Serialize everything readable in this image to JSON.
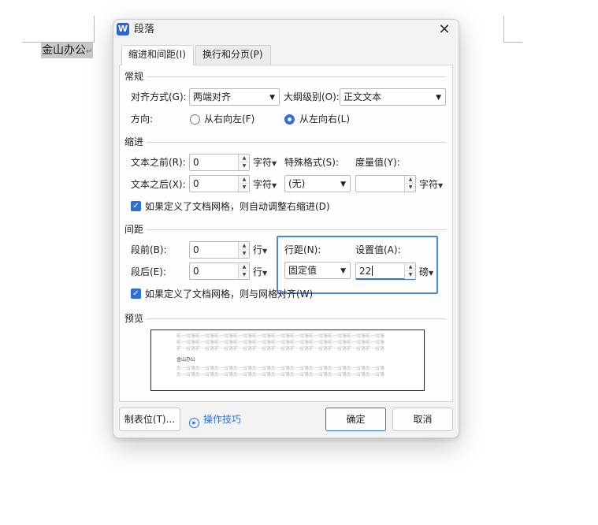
{
  "document": {
    "text": "金山办公",
    "para_mark": "↵"
  },
  "dialog": {
    "app_icon": "W",
    "title": "段落",
    "close_glyph": "✕",
    "tabs": [
      {
        "label": "缩进和间距(I)",
        "active": true
      },
      {
        "label": "换行和分页(P)",
        "active": false
      }
    ],
    "general": {
      "title": "常规",
      "alignment_label": "对齐方式(G):",
      "alignment_value": "两端对齐",
      "outline_label": "大纲级别(O):",
      "outline_value": "正文文本",
      "direction_label": "方向:",
      "direction_options": [
        "从右向左(F)",
        "从左向右(L)"
      ],
      "direction_selected": "从左向右(L)"
    },
    "indent": {
      "title": "缩进",
      "before_label": "文本之前(R):",
      "before_value": "0",
      "after_label": "文本之后(X):",
      "after_value": "0",
      "unit": "字符",
      "special_label": "特殊格式(S):",
      "special_value": "(无)",
      "measure_label": "度量值(Y):",
      "measure_value": "",
      "measure_unit": "字符",
      "grid_checkbox_label": "如果定义了文档网格，则自动调整右缩进(D)",
      "grid_checkbox_checked": true
    },
    "spacing": {
      "title": "间距",
      "before_label": "段前(B):",
      "before_value": "0",
      "after_label": "段后(E):",
      "after_value": "0",
      "unit": "行",
      "line_spacing_label": "行距(N):",
      "line_spacing_value": "固定值",
      "set_value_label": "设置值(A):",
      "set_value": "22",
      "set_value_unit": "磅",
      "grid_checkbox_label": "如果定义了文档网格，则与网格对齐(W)",
      "grid_checkbox_checked": true
    },
    "preview": {
      "title": "预览",
      "prev_para": "前一段落前一段落前一段落前一段落前一段落前一段落前一段落前一段落前一段落前一段落前一段落",
      "sample_text": "金山办公",
      "next_para": "后一段落后一段落后一段落后一段落后一段落后一段落后一段落后一段落后一段落后一段落后一段落"
    },
    "buttons": {
      "tabs_label": "制表位(T)...",
      "tips_label": "操作技巧",
      "ok_label": "确定",
      "cancel_label": "取消"
    }
  },
  "colors": {
    "accent": "#2f6fd6",
    "highlight_box": "#4a87e5"
  },
  "icons": [
    "wps-writer-icon",
    "close-icon",
    "dropdown-arrow-icon",
    "spin-up-icon",
    "spin-down-icon",
    "checkbox-checked-icon",
    "radio-icon",
    "play-circle-icon"
  ]
}
